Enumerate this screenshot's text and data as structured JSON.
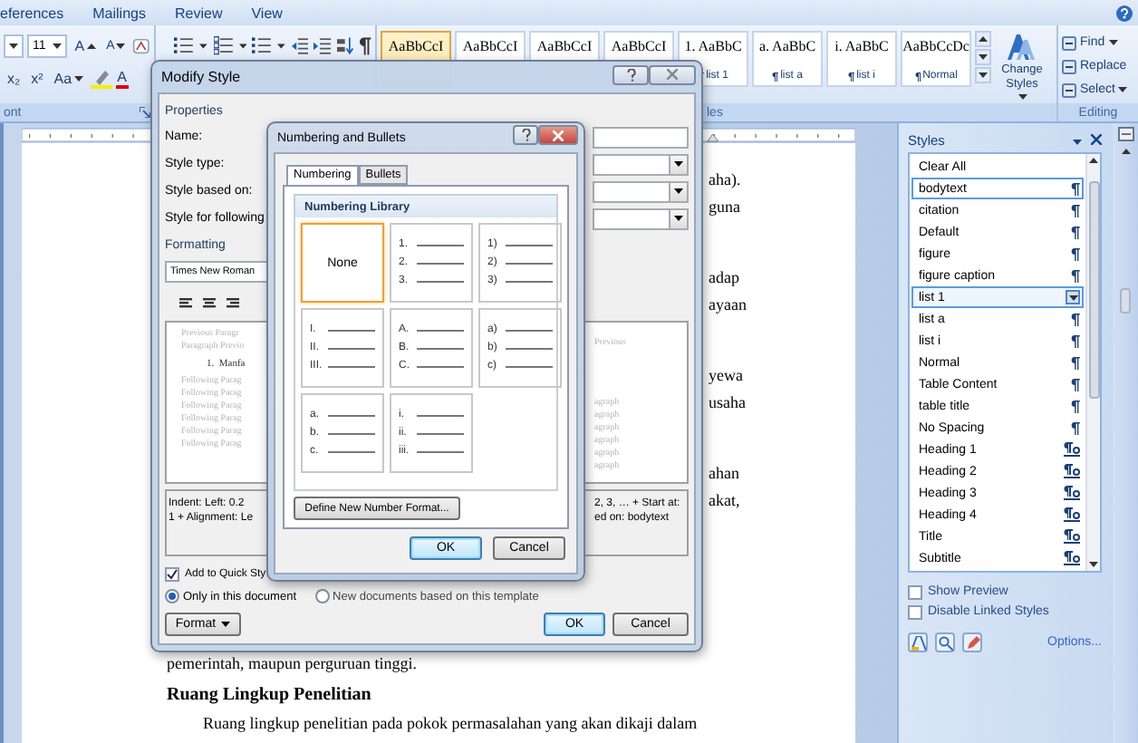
{
  "ribbon": {
    "tabs": [
      {
        "label": "eferences"
      },
      {
        "label": "Mailings"
      },
      {
        "label": "Review"
      },
      {
        "label": "View"
      }
    ],
    "font_group": {
      "label": "ont",
      "size": "11",
      "grow": "A",
      "shrink": "A",
      "subscript": "x₂",
      "superscript": "x²",
      "change_case": "Aa",
      "font_color": "A"
    },
    "quick_styles": [
      {
        "sample": "AaBbCcI",
        "selected": true
      },
      {
        "sample": "AaBbCcI",
        "selected": false
      },
      {
        "sample": "AaBbCcI",
        "selected": false
      },
      {
        "sample": "AaBbCcI",
        "selected": false
      },
      {
        "number": "1.",
        "sample": "AaBbC",
        "name": "list 1",
        "selected": false
      },
      {
        "number": "a.",
        "sample": "AaBbC",
        "name": "list a",
        "selected": false
      },
      {
        "number": "i.",
        "sample": "AaBbC",
        "name": "list i",
        "selected": false
      },
      {
        "sample": "AaBbCcDc",
        "name": "Normal",
        "selected": false
      }
    ],
    "styles_label": "les",
    "change_styles": "Change Styles",
    "editing": {
      "label": "Editing",
      "items": [
        {
          "label": "Find",
          "menu": true
        },
        {
          "label": "Replace",
          "menu": false
        },
        {
          "label": "Select",
          "menu": true
        }
      ]
    }
  },
  "document": {
    "fragments": [
      [
        "aha).",
        "guna"
      ],
      [
        "adap",
        "ayaan"
      ],
      [
        "yewa",
        "usaha"
      ],
      [
        "ahan",
        "akat,"
      ]
    ],
    "paragraph_end": "pemerintah, maupun perguruan tinggi.",
    "heading": "Ruang Lingkup Penelitian",
    "paragraph": "Ruang lingkup penelitian pada pokok permasalahan yang akan dikaji dalam"
  },
  "modify_style": {
    "title": "Modify Style",
    "properties_label": "Properties",
    "properties": [
      {
        "label": "Name:",
        "kind": "text"
      },
      {
        "label": "Style type:",
        "kind": "dropdown"
      },
      {
        "label": "Style based on:",
        "kind": "dropdown"
      },
      {
        "label": "Style for following",
        "kind": "dropdown"
      }
    ],
    "formatting_label": "Formatting",
    "font": "Times New Roman",
    "preview": {
      "previous": [
        "Previous Paragr",
        "Paragraph Previo"
      ],
      "item_number": "1.",
      "item_text": "Manfa",
      "following": [
        "Following Parag",
        "Following Parag",
        "Following Parag",
        "Following Parag",
        "Following Parag",
        "Following Parag"
      ],
      "right_previous": "Previous",
      "right_following": [
        "agraph",
        "agraph",
        "agraph",
        "agraph",
        "agraph",
        "agraph"
      ]
    },
    "description": {
      "left": [
        "Indent: Left: 0.2",
        "1 + Alignment: Le"
      ],
      "right": [
        "2, 3, … + Start at:",
        "ed on: bodytext"
      ]
    },
    "add_to_quick_styles": {
      "label": "Add to Quick Sty",
      "checked": true
    },
    "scope": [
      {
        "label": "Only in this document",
        "selected": true
      },
      {
        "label": "New documents based on this template",
        "selected": false
      }
    ],
    "format_button": "Format",
    "ok": "OK",
    "cancel": "Cancel"
  },
  "numbering": {
    "title": "Numbering and Bullets",
    "tabs": [
      {
        "label": "Numbering",
        "selected": true
      },
      {
        "label": "Bullets",
        "selected": false
      }
    ],
    "library_title": "Numbering Library",
    "formats": [
      {
        "kind": "none",
        "label": "None",
        "selected": true
      },
      {
        "kind": "list",
        "markers": [
          "1.",
          "2.",
          "3."
        ],
        "selected": false
      },
      {
        "kind": "list",
        "markers": [
          "1)",
          "2)",
          "3)"
        ],
        "selected": false
      },
      {
        "kind": "list",
        "markers": [
          "I.",
          "II.",
          "III."
        ],
        "selected": false
      },
      {
        "kind": "list",
        "markers": [
          "A.",
          "B.",
          "C."
        ],
        "selected": false
      },
      {
        "kind": "list",
        "markers": [
          "a)",
          "b)",
          "c)"
        ],
        "selected": false
      },
      {
        "kind": "list",
        "markers": [
          "a.",
          "b.",
          "c."
        ],
        "selected": false
      },
      {
        "kind": "list",
        "markers": [
          "i.",
          "ii.",
          "iii."
        ],
        "selected": false
      }
    ],
    "define_button": "Define New Number Format...",
    "ok": "OK",
    "cancel": "Cancel"
  },
  "styles_pane": {
    "title": "Styles",
    "items": [
      {
        "label": "Clear All",
        "kind": "clear",
        "highlighted": false,
        "selected": false
      },
      {
        "label": "bodytext",
        "kind": "paragraph",
        "highlighted": true,
        "selected": false
      },
      {
        "label": "citation",
        "kind": "paragraph",
        "highlighted": false,
        "selected": false
      },
      {
        "label": "Default",
        "kind": "paragraph",
        "highlighted": false,
        "selected": false
      },
      {
        "label": "figure",
        "kind": "paragraph",
        "highlighted": false,
        "selected": false
      },
      {
        "label": "figure caption",
        "kind": "paragraph",
        "highlighted": false,
        "selected": false
      },
      {
        "label": "list 1",
        "kind": "paragraph",
        "highlighted": false,
        "selected": true
      },
      {
        "label": "list a",
        "kind": "paragraph",
        "highlighted": false,
        "selected": false
      },
      {
        "label": "list i",
        "kind": "paragraph",
        "highlighted": false,
        "selected": false
      },
      {
        "label": "Normal",
        "kind": "paragraph",
        "highlighted": false,
        "selected": false
      },
      {
        "label": "Table Content",
        "kind": "paragraph",
        "highlighted": false,
        "selected": false
      },
      {
        "label": "table title",
        "kind": "paragraph",
        "highlighted": false,
        "selected": false
      },
      {
        "label": "No Spacing",
        "kind": "paragraph",
        "highlighted": false,
        "selected": false
      },
      {
        "label": "Heading 1",
        "kind": "linked",
        "highlighted": false,
        "selected": false
      },
      {
        "label": "Heading 2",
        "kind": "linked",
        "highlighted": false,
        "selected": false
      },
      {
        "label": "Heading 3",
        "kind": "linked",
        "highlighted": false,
        "selected": false
      },
      {
        "label": "Heading 4",
        "kind": "linked",
        "highlighted": false,
        "selected": false
      },
      {
        "label": "Title",
        "kind": "linked",
        "highlighted": false,
        "selected": false
      },
      {
        "label": "Subtitle",
        "kind": "linked",
        "highlighted": false,
        "selected": false
      }
    ],
    "options": [
      {
        "label": "Show Preview",
        "checked": false
      },
      {
        "label": "Disable Linked Styles",
        "checked": false
      }
    ],
    "options_link": "Options..."
  }
}
